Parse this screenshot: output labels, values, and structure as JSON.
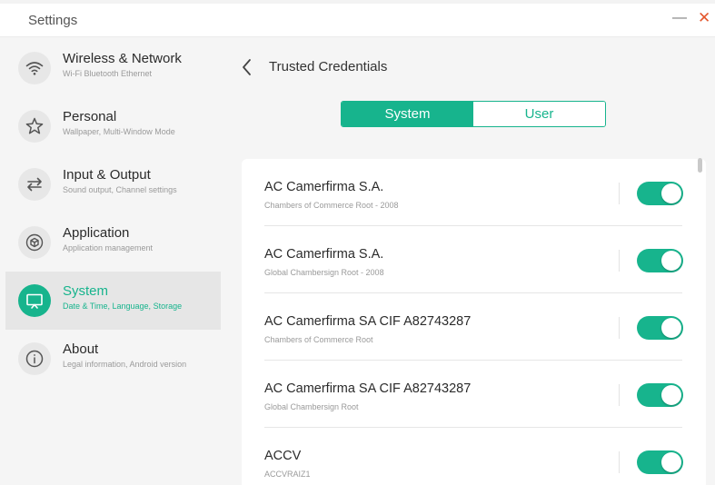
{
  "window": {
    "title": "Settings",
    "minimize": "—",
    "close": "✕"
  },
  "sidebar": {
    "items": [
      {
        "title": "Wireless & Network",
        "subtitle": "Wi-Fi Bluetooth Ethernet",
        "icon": "wifi-icon"
      },
      {
        "title": "Personal",
        "subtitle": "Wallpaper, Multi-Window Mode",
        "icon": "star-icon"
      },
      {
        "title": "Input & Output",
        "subtitle": "Sound output, Channel settings",
        "icon": "arrows-swap-icon"
      },
      {
        "title": "Application",
        "subtitle": "Application management",
        "icon": "cube-icon"
      },
      {
        "title": "System",
        "subtitle": "Date & Time, Language, Storage",
        "icon": "monitor-icon",
        "active": true
      },
      {
        "title": "About",
        "subtitle": "Legal information, Android version",
        "icon": "info-icon"
      }
    ]
  },
  "main": {
    "title": "Trusted Credentials",
    "tabs": [
      {
        "label": "System",
        "selected": true
      },
      {
        "label": "User",
        "selected": false
      }
    ],
    "credentials": [
      {
        "title": "AC Camerfirma S.A.",
        "subtitle": "Chambers of Commerce Root - 2008",
        "enabled": true
      },
      {
        "title": "AC Camerfirma S.A.",
        "subtitle": "Global Chambersign Root - 2008",
        "enabled": true
      },
      {
        "title": "AC Camerfirma SA CIF A82743287",
        "subtitle": "Chambers of Commerce Root",
        "enabled": true
      },
      {
        "title": "AC Camerfirma SA CIF A82743287",
        "subtitle": "Global Chambersign Root",
        "enabled": true
      },
      {
        "title": "ACCV",
        "subtitle": "ACCVRAIZ1",
        "enabled": true
      }
    ]
  },
  "colors": {
    "accent": "#17b48d",
    "close": "#e4572e",
    "background": "#f5f5f5"
  }
}
